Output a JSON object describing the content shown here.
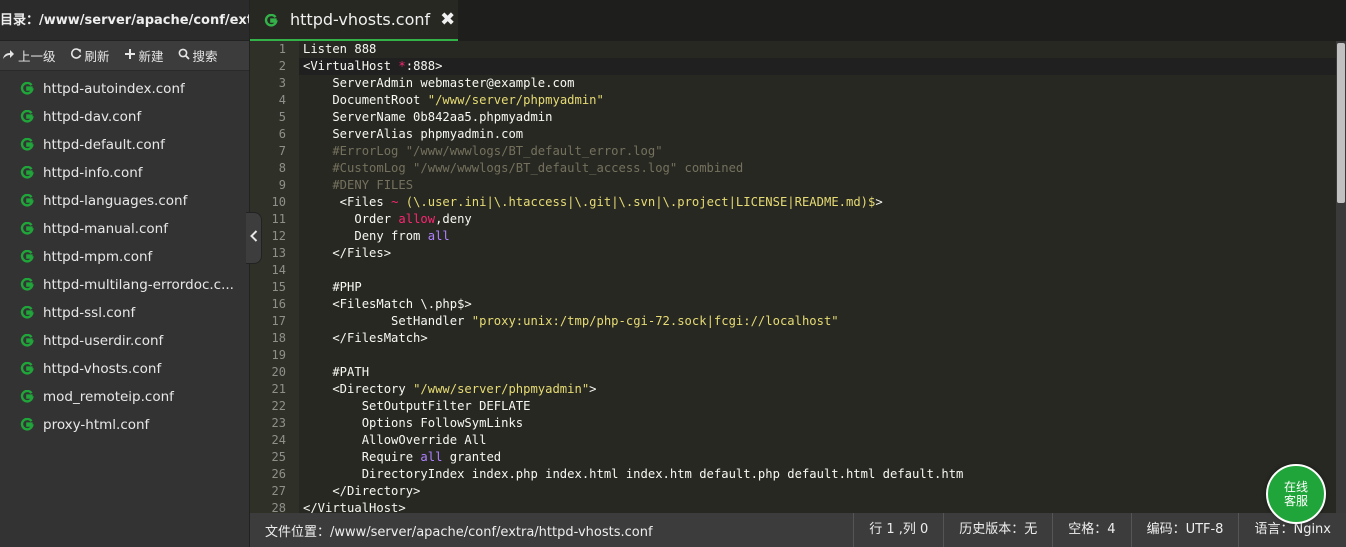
{
  "sidebar": {
    "dir_label": "目录：/www/server/apache/conf/extra",
    "toolbar": {
      "up_label": "上一级",
      "refresh_label": "刷新",
      "new_label": "新建",
      "search_label": "搜索"
    },
    "files": [
      {
        "name": "httpd-autoindex.conf"
      },
      {
        "name": "httpd-dav.conf"
      },
      {
        "name": "httpd-default.conf"
      },
      {
        "name": "httpd-info.conf"
      },
      {
        "name": "httpd-languages.conf"
      },
      {
        "name": "httpd-manual.conf"
      },
      {
        "name": "httpd-mpm.conf"
      },
      {
        "name": "httpd-multilang-errordoc.c..."
      },
      {
        "name": "httpd-ssl.conf"
      },
      {
        "name": "httpd-userdir.conf"
      },
      {
        "name": "httpd-vhosts.conf"
      },
      {
        "name": "mod_remoteip.conf"
      },
      {
        "name": "proxy-html.conf"
      }
    ]
  },
  "tabs": [
    {
      "label": "httpd-vhosts.conf",
      "icon": "file-g-icon",
      "active": true
    }
  ],
  "editor": {
    "line_numbers": [
      "1",
      "2",
      "3",
      "4",
      "5",
      "6",
      "7",
      "8",
      "9",
      "10",
      "11",
      "12",
      "13",
      "14",
      "15",
      "16",
      "17",
      "18",
      "19",
      "20",
      "21",
      "22",
      "23",
      "24",
      "25",
      "26",
      "27",
      "28"
    ],
    "lines": [
      [
        [
          "",
          "Listen 888"
        ]
      ],
      [
        [
          "",
          "<VirtualHost "
        ],
        [
          "kw",
          "*"
        ],
        [
          "",
          ":888>"
        ]
      ],
      [
        [
          "",
          "    ServerAdmin webmaster@example.com"
        ]
      ],
      [
        [
          "",
          "    DocumentRoot "
        ],
        [
          "str",
          "\"/www/server/phpmyadmin\""
        ]
      ],
      [
        [
          "",
          "    ServerName 0b842aa5.phpmyadmin"
        ]
      ],
      [
        [
          "",
          "    ServerAlias phpmyadmin.com"
        ]
      ],
      [
        [
          "com",
          "    #ErrorLog \"/www/wwwlogs/BT_default_error.log\""
        ]
      ],
      [
        [
          "com",
          "    #CustomLog \"/www/wwwlogs/BT_default_access.log\" combined"
        ]
      ],
      [
        [
          "com",
          "    #DENY FILES"
        ]
      ],
      [
        [
          "",
          "     <Files "
        ],
        [
          "kw",
          "~"
        ],
        [
          "",
          " "
        ],
        [
          "str",
          "(\\.user.ini|\\.htaccess|\\.git|\\.svn|\\.project|LICENSE|README.md)$"
        ],
        [
          "",
          ">"
        ]
      ],
      [
        [
          "",
          "       Order "
        ],
        [
          "kw",
          "allow"
        ],
        [
          "",
          ",deny"
        ]
      ],
      [
        [
          "",
          "       Deny from "
        ],
        [
          "const",
          "all"
        ]
      ],
      [
        [
          "",
          "    </Files>"
        ]
      ],
      [
        [
          "",
          ""
        ]
      ],
      [
        [
          "",
          "    #PHP"
        ]
      ],
      [
        [
          "",
          "    <FilesMatch \\.php$>"
        ]
      ],
      [
        [
          "",
          "            SetHandler "
        ],
        [
          "str",
          "\"proxy:unix:/tmp/php-cgi-72.sock|fcgi://localhost\""
        ]
      ],
      [
        [
          "",
          "    </FilesMatch>"
        ]
      ],
      [
        [
          "",
          ""
        ]
      ],
      [
        [
          "",
          "    #PATH"
        ]
      ],
      [
        [
          "",
          "    <Directory "
        ],
        [
          "str",
          "\"/www/server/phpmyadmin\""
        ],
        [
          "",
          ">"
        ]
      ],
      [
        [
          "",
          "        SetOutputFilter DEFLATE"
        ]
      ],
      [
        [
          "",
          "        Options FollowSymLinks"
        ]
      ],
      [
        [
          "",
          "        AllowOverride All"
        ]
      ],
      [
        [
          "",
          "        Require "
        ],
        [
          "const",
          "all"
        ],
        [
          "",
          " granted"
        ]
      ],
      [
        [
          "",
          "        DirectoryIndex index.php index.html index.htm default.php default.html default.htm"
        ]
      ],
      [
        [
          "",
          "    </Directory>"
        ]
      ],
      [
        [
          "",
          "</VirtualHost>"
        ]
      ]
    ]
  },
  "statusbar": {
    "file_path": "文件位置：/www/server/apache/conf/extra/httpd-vhosts.conf",
    "cursor": "行 1 ,列 0",
    "history": "历史版本：无",
    "indent": "空格：4",
    "encoding": "编码：UTF-8",
    "language": "语言：Nginx"
  },
  "help_button": {
    "line1": "在线",
    "line2": "客服"
  },
  "colors": {
    "accent": "#20a53a",
    "tab_underline": "#34b24a",
    "string": "#e6db74",
    "keyword": "#f92672",
    "constant": "#ae81ff",
    "comment": "#75715e"
  }
}
